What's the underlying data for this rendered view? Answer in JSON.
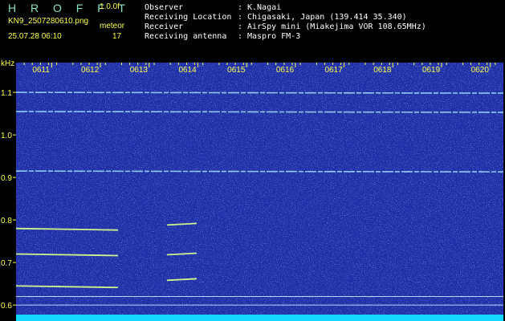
{
  "app": {
    "title": "H R O F F T",
    "version": "1.0.0f",
    "filename": "KN9_2507280610.png",
    "datetime": "25.07.28 06:10",
    "counter_label": "meteor",
    "counter_value": "17"
  },
  "info": {
    "rows": [
      {
        "label": "Observer",
        "value": "K.Nagai"
      },
      {
        "label": "Receiving Location",
        "value": "Chigasaki, Japan (139.414 35.340)"
      },
      {
        "label": "Receiver",
        "value": "AirSpy mini (Miakejima VOR 108.65MHz)"
      },
      {
        "label": "Receiving antenna",
        "value": "Maspro FM-3"
      }
    ]
  },
  "chart_data": {
    "type": "heatmap",
    "ylabel": "kHz",
    "y_ticks": [
      "1.1",
      "1.0",
      "0.9",
      "0.8",
      "0.7",
      "0.6"
    ],
    "y_values": [
      1.1,
      1.0,
      0.9,
      0.8,
      0.7,
      0.6
    ],
    "time_ticks": [
      "0611",
      "0612",
      "0613",
      "0614",
      "0615",
      "0616",
      "0617",
      "0618",
      "0619",
      "0620"
    ],
    "ylim": [
      0.57,
      1.17
    ],
    "background_color": "#1f2fa8",
    "trace_color": "#9fe6ff",
    "echo_color": "#d8ff8a",
    "horizontal_traces": [
      1.1,
      1.055,
      0.915
    ],
    "echoes_left": [
      0.78,
      0.72,
      0.645
    ],
    "echoes_mid": [
      0.79,
      0.72,
      0.66
    ],
    "reference_lines": [
      0.62,
      0.6
    ]
  }
}
